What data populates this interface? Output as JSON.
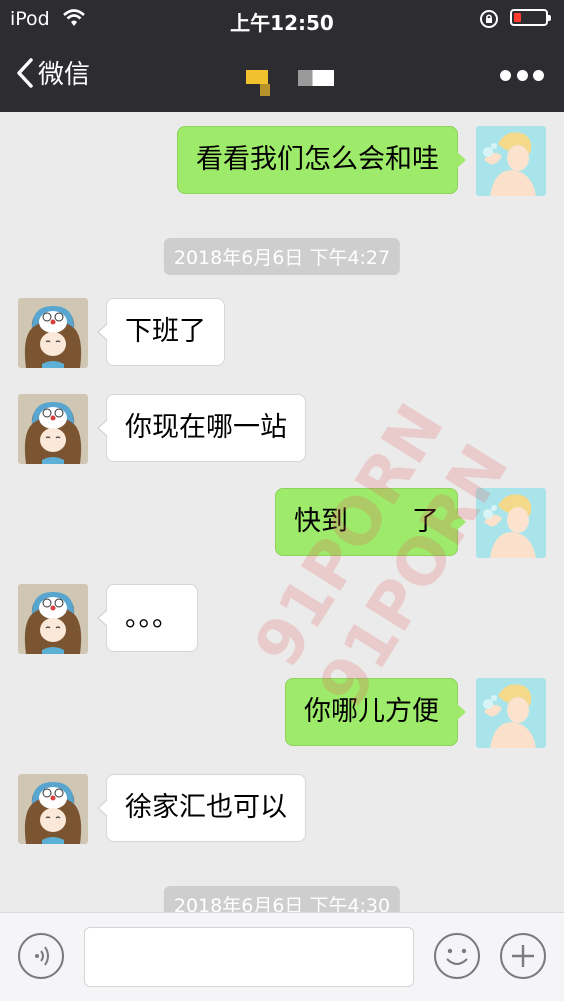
{
  "status_bar": {
    "carrier": "iPod",
    "time": "上午12:50"
  },
  "nav": {
    "back_label": "微信"
  },
  "messages": [
    {
      "side": "out",
      "text": "看看我们怎么会和哇"
    },
    {
      "side": "time",
      "text": "2018年6月6日 下午4:27"
    },
    {
      "side": "in",
      "text": "下班了"
    },
    {
      "side": "in",
      "text": "你现在哪一站"
    },
    {
      "side": "out",
      "text_before": "快到",
      "text_after": "了"
    },
    {
      "side": "in",
      "text": "。。。"
    },
    {
      "side": "out",
      "text": "你哪儿方便"
    },
    {
      "side": "in",
      "text": "徐家汇也可以"
    },
    {
      "side": "time",
      "text": "2018年6月6日 下午4:30"
    }
  ],
  "input": {
    "value": ""
  },
  "watermark": [
    "91PORN",
    "91PORN"
  ],
  "colors": {
    "nav_background": "#2d2c31",
    "chat_background": "#ebebeb",
    "outgoing_bubble": "#9eea6a",
    "incoming_bubble": "#ffffff",
    "battery_low": "#ff3b30"
  },
  "icons": [
    "wifi-icon",
    "orientation-lock-icon",
    "battery-icon",
    "back-chevron-icon",
    "more-icon",
    "voice-icon",
    "emoji-icon",
    "plus-icon"
  ]
}
